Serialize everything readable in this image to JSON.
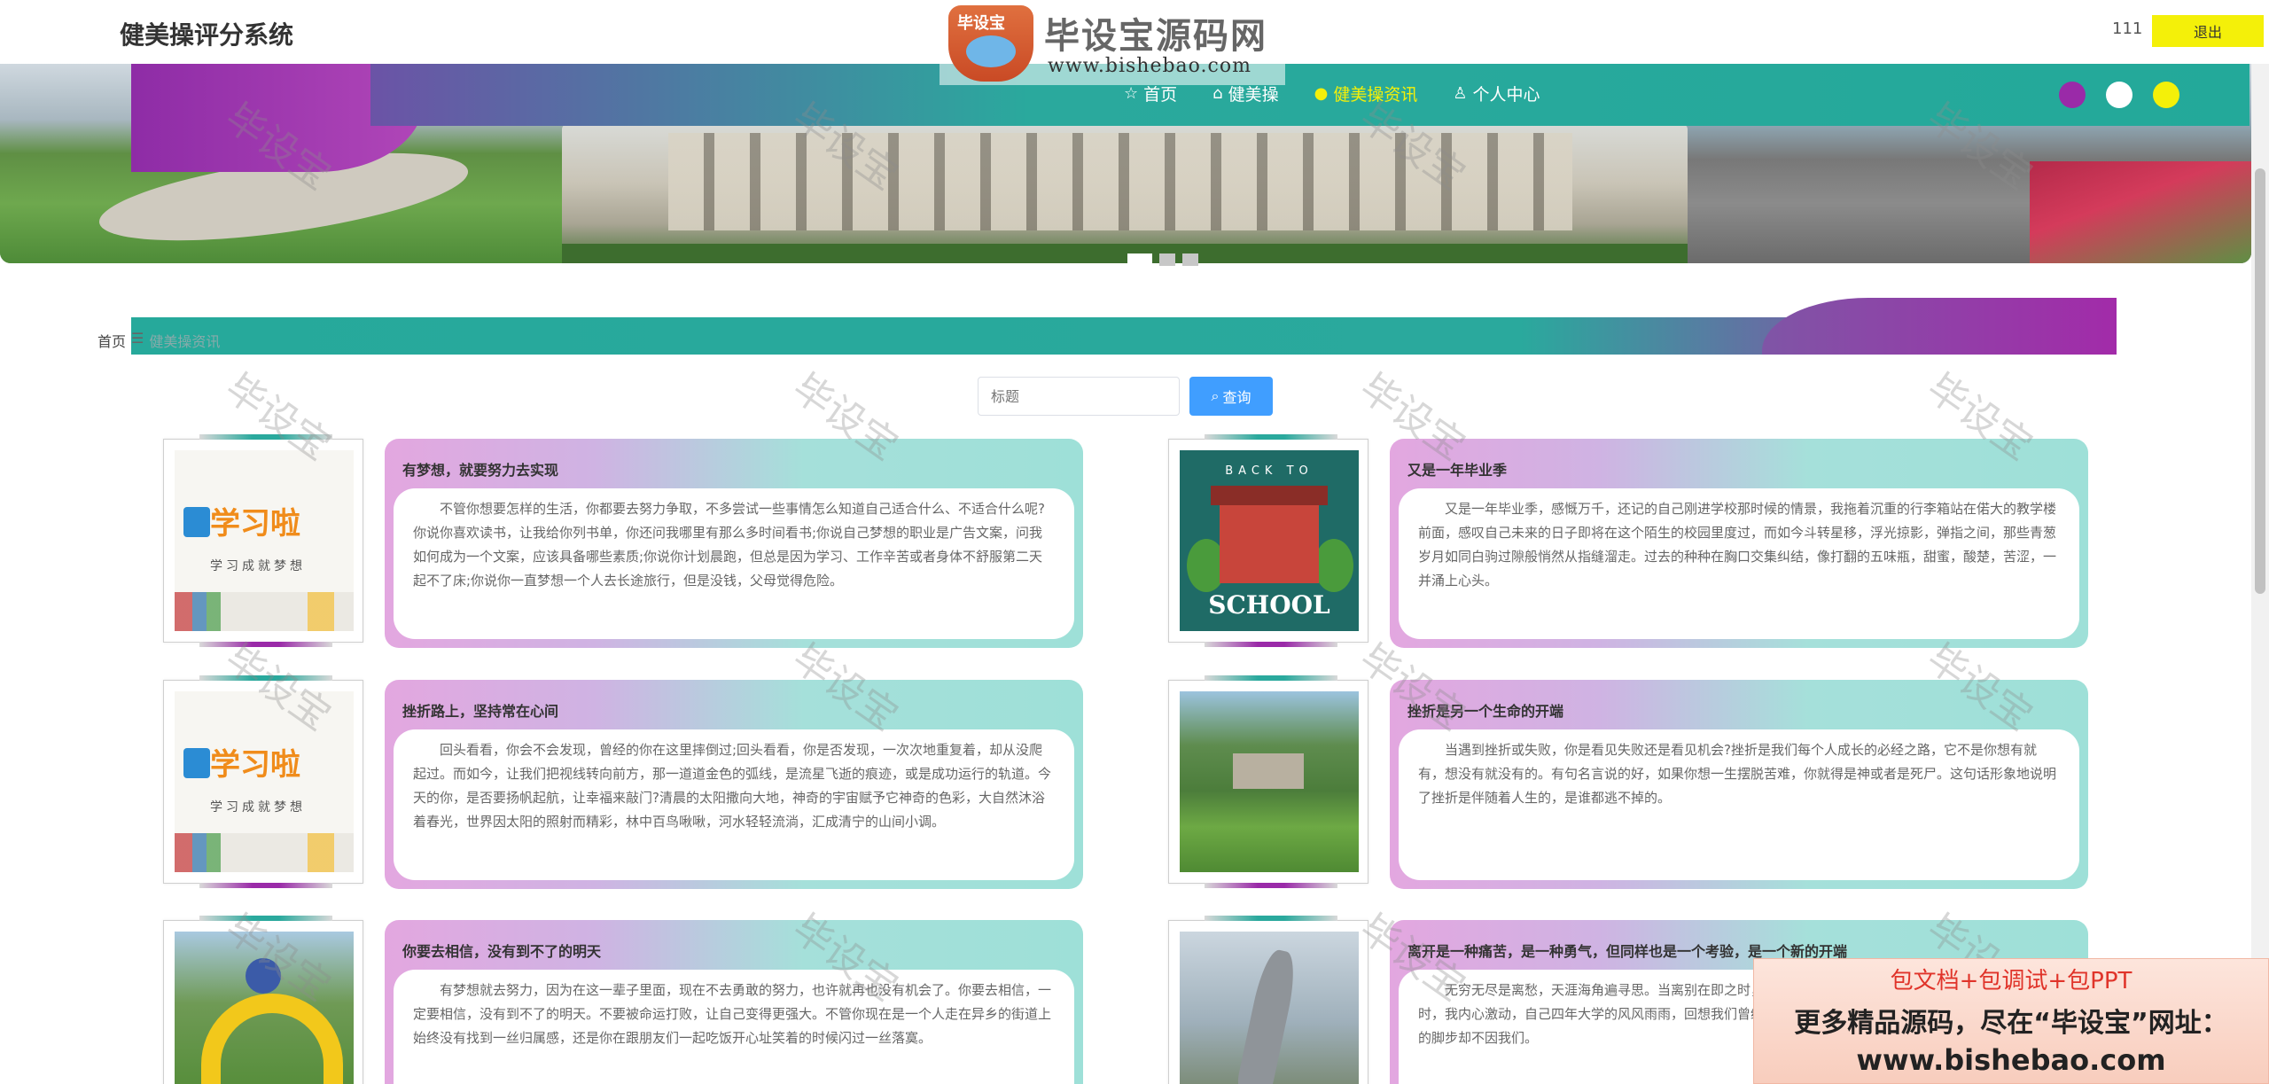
{
  "header": {
    "title": "健美操评分系统",
    "user": "111",
    "logout_label": "退出"
  },
  "nav": {
    "items": [
      {
        "label": "首页",
        "icon": "star-icon",
        "glyph": "☆"
      },
      {
        "label": "健美操",
        "icon": "house-icon",
        "glyph": "⌂"
      },
      {
        "label": "健美操资讯",
        "icon": "news-icon",
        "glyph": "●",
        "active": true
      },
      {
        "label": "个人中心",
        "icon": "user-icon",
        "glyph": "♙"
      }
    ],
    "theme_colors": [
      "#9a2aa8",
      "#ffffff",
      "#f4f009"
    ],
    "active_color": "#f4f009"
  },
  "banner": {
    "next_glyph": "›",
    "slide_count": 3,
    "active_slide": 1
  },
  "breadcrumb": {
    "home": "首页",
    "separator": "☰",
    "current": "健美操资讯"
  },
  "search": {
    "placeholder": "标题",
    "button_label": "查询",
    "button_glyph": "⌕"
  },
  "articles": [
    {
      "title": "有梦想，就要努力去实现",
      "text": "不管你想要怎样的生活，你都要去努力争取，不多尝试一些事情怎么知道自己适合什么、不适合什么呢?你说你喜欢读书，让我给你列书单，你还问我哪里有那么多时间看书;你说自己梦想的职业是广告文案，问我如何成为一个文案，应该具备哪些素质;你说你计划晨跑，但总是因为学习、工作辛苦或者身体不舒服第二天起不了床;你说你一直梦想一个人去长途旅行，但是没钱，父母觉得危险。",
      "thumb": "logo"
    },
    {
      "title": "又是一年毕业季",
      "text": "又是一年毕业季，感慨万千，还记的自己刚进学校那时候的情景，我拖着沉重的行李箱站在偌大的教学楼前面，感叹自己未来的日子即将在这个陌生的校园里度过，而如今斗转星移，浮光掠影，弹指之间，那些青葱岁月如同白驹过隙般悄然从指缝溜走。过去的种种在胸口交集纠结，像打翻的五味瓶，甜蜜，酸楚，苦涩，一并涌上心头。",
      "thumb": "school",
      "thumb_top": "BACK TO",
      "thumb_bottom": "SCHOOL"
    },
    {
      "title": "挫折路上，坚持常在心间",
      "text": "回头看看，你会不会发现，曾经的你在这里摔倒过;回头看看，你是否发现，一次次地重复着，却从没爬起过。而如今，让我们把视线转向前方，那一道道金色的弧线，是流星飞逝的痕迹，或是成功运行的轨道。今天的你，是否要扬帆起航，让幸福来敲门?清晨的太阳撒向大地，神奇的宇宙赋予它神奇的色彩，大自然沐浴着春光，世界因太阳的照射而精彩，林中百鸟啾啾，河水轻轻流淌，汇成清宁的山间小调。",
      "thumb": "logo"
    },
    {
      "title": "挫折是另一个生命的开端",
      "text": "当遇到挫折或失败，你是看见失败还是看见机会?挫折是我们每个人成长的必经之路，它不是你想有就有，想没有就没有的。有句名言说的好，如果你想一生摆脱苦难，你就得是神或者是死尸。这句话形象地说明了挫折是伴随着人生的，是谁都逃不掉的。",
      "thumb": "park"
    },
    {
      "title": "你要去相信，没有到不了的明天",
      "text": "有梦想就去努力，因为在这一辈子里面，现在不去勇敢的努力，也许就再也没有机会了。你要去相信，一定要相信，没有到不了的明天。不要被命运打败，让自己变得更强大。不管你现在是一个人走在异乡的街道上始终没有找到一丝归属感，还是你在跟朋友们一起吃饭开心址笑着的时候闪过一丝落寞。",
      "thumb": "sport"
    },
    {
      "title": "离开是一种痛苦，是一种勇气，但同样也是一个考验，是一个新的开端",
      "text": "无穷无尽是离愁，天涯海角遍寻思。当离别在即之时，才发现，经历了四年的磨合而形成的真挚友谊之时，我内心激动，自己四年大学的风风雨雨，回想我们曾经共同经历的我大支持与帮助。虽然舍不得，但离别的脚步却不因我们。",
      "thumb": "sculpt"
    }
  ],
  "watermark": {
    "text": "毕设宝"
  },
  "site_logo": {
    "badge": "毕设宝",
    "brand": "毕设宝源码网",
    "url": "www.bishebao.com"
  },
  "promo": {
    "line1": "包文档+包调试+包PPT",
    "line2": "更多精品源码，尽在“毕设宝”网址：",
    "line3": "www.bishebao.com"
  }
}
